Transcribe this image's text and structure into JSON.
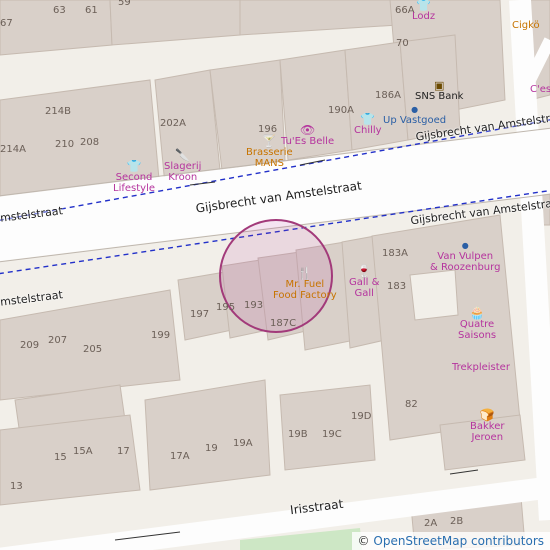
{
  "map": {
    "streets": [
      "Gijsbrecht van Amstelstraat",
      "Gijsbrecht van Amstelstraat",
      "Gijsbrecht van Amstelstraat",
      "Gijsbrecht van Amstelstraat",
      "Gijsbrecht van Amstelstraat",
      "Irisstraat"
    ],
    "street_partial": [
      "mstelstraat",
      "mstelstraat",
      "Cigkö"
    ],
    "house_numbers": [
      "67",
      "63",
      "61",
      "59",
      "66A",
      "70",
      "214B",
      "202A",
      "196",
      "190A",
      "186A",
      "214A",
      "210",
      "208",
      "183A",
      "183",
      "197",
      "195",
      "193",
      "187C",
      "209",
      "207",
      "205",
      "199",
      "82",
      "19D",
      "19B",
      "19C",
      "15",
      "15A",
      "17",
      "17A",
      "19",
      "19A",
      "13",
      "2A",
      "2B"
    ],
    "pois": {
      "lodz": "Lodz",
      "sns_bank": "SNS Bank",
      "up_vastgoed": "Up Vastgoed",
      "chilly": "Chilly",
      "tu_es_belle": "Tu'Es Belle",
      "brasserie_mans_1": "Brasserie",
      "brasserie_mans_2": "MANS",
      "slagerij_1": "Slagerij",
      "slagerij_2": "Kroon",
      "second_1": "Second",
      "second_2": "Lifestyle",
      "mr_fuel_1": "Mr. Fuel",
      "mr_fuel_2": "Food Factory",
      "gall_1": "Gall &",
      "gall_2": "Gall",
      "van_vulpen_1": "Van Vulpen",
      "van_vulpen_2": "& Roozenburg",
      "quatre_1": "Quatre",
      "quatre_2": "Saisons",
      "trekpleister": "Trekpleister",
      "bakker_1": "Bakker",
      "bakker_2": "Jeroen",
      "ces": "C'es"
    },
    "attribution": {
      "symbol": "©",
      "link": "OpenStreetMap contributors"
    },
    "colors": {
      "background": "#f2efe9",
      "building": "#d9d0c9",
      "road": "#ffffff",
      "cycleway": "#0000ff",
      "highlight": "#b5349e"
    }
  }
}
